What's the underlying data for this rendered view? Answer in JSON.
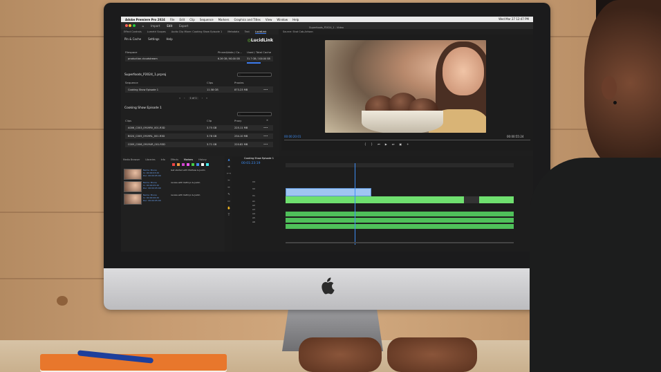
{
  "menubar": {
    "app": "Adobe Premiere Pro 2024",
    "items": [
      "File",
      "Edit",
      "Clip",
      "Sequence",
      "Markers",
      "Graphics and Titles",
      "View",
      "Window",
      "Help"
    ],
    "clock": "Wed Mar 27  12:47 PM"
  },
  "appbar": {
    "tabs": [
      "Import",
      "Edit",
      "Export"
    ]
  },
  "panel_tabs": [
    "Effect Controls",
    "Lumetri Scopes",
    "Audio Clip Mixer: Cooking Show Episode 1",
    "Metadata",
    "Text",
    "LucidLink"
  ],
  "lucid": {
    "pin_cache": "Pin & Cache",
    "settings": "Settings",
    "help": "Help",
    "logo": "LucidLink",
    "filespace_label": "Filespace",
    "pinned_label": "Pinned/data / Ca...",
    "used_label": "Used / Total Cache",
    "filespace_name": "production.cloudstream",
    "pinned_value": "6.26 GB / 60.00 GB",
    "used_value": "31.7 GB / 100.00 GB",
    "project_title": "Superfoods_P2024_1.prproj",
    "seq_col": "Sequence",
    "clips_col": "Clips",
    "proxies_col": "Proxies",
    "sequence_name": "Cooking Show Episode 1",
    "sequence_clips": "11.58 GB",
    "sequence_proxy": "873.23 MB",
    "pager": "1 of 1",
    "section2": "Cooking Show Episode 1",
    "clip_col": "Clips",
    "clip_col2": "Clip",
    "proxy_col": "Proxy",
    "clips": [
      {
        "name": "A006_C003_0919RV_001.R3D",
        "size": "3.75 GB",
        "proxy": "225.11 MB"
      },
      {
        "name": "B024_C005_0919RL_001.R3D",
        "size": "3.78 GB",
        "proxy": "234.10 MB"
      },
      {
        "name": "C009_C006_0919UR_001.R3D",
        "size": "3.71 GB",
        "proxy": "220.82 MB"
      }
    ]
  },
  "preview": {
    "tab": "Superfoods_P2024_1 - Video",
    "source_tab": "Source: Shot Cab-Artisan",
    "timecode_left": "00:00:20:01",
    "timecode_right": "00:00:55:24"
  },
  "project_panel": {
    "tabs": [
      "Media Browser",
      "Libraries",
      "Info",
      "Effects",
      "Markers",
      "History"
    ],
    "items": [
      {
        "name": "Name: Brune",
        "in": "In: 00:00:03:20",
        "dur": "Dur: 00:00:05:00",
        "note": "Get started with Mathew & Justin"
      },
      {
        "name": "Name: Brune",
        "in": "In: 00:00:05:20",
        "dur": "Dur: 00:00:05:00",
        "note": "review with Kathryn & Justin"
      },
      {
        "name": "Name: Brune",
        "in": "In: 00:00:06:20",
        "dur": "Dur: 00:00:05:00",
        "note": "review with Kathryn & Justin"
      }
    ]
  },
  "timeline": {
    "sequence_tab": "Cooking Show Episode 1",
    "timecode": "00:01:23:19",
    "tracks": [
      "V3",
      "V2",
      "V1",
      "A1",
      "A2",
      "A3",
      "A4",
      "A5",
      "A6"
    ]
  },
  "colors": {
    "accent": "#3d8df5",
    "green_clip": "#6fe06f",
    "blue_clip": "#9fc5f2",
    "lucid_green": "#6ecb3a"
  }
}
